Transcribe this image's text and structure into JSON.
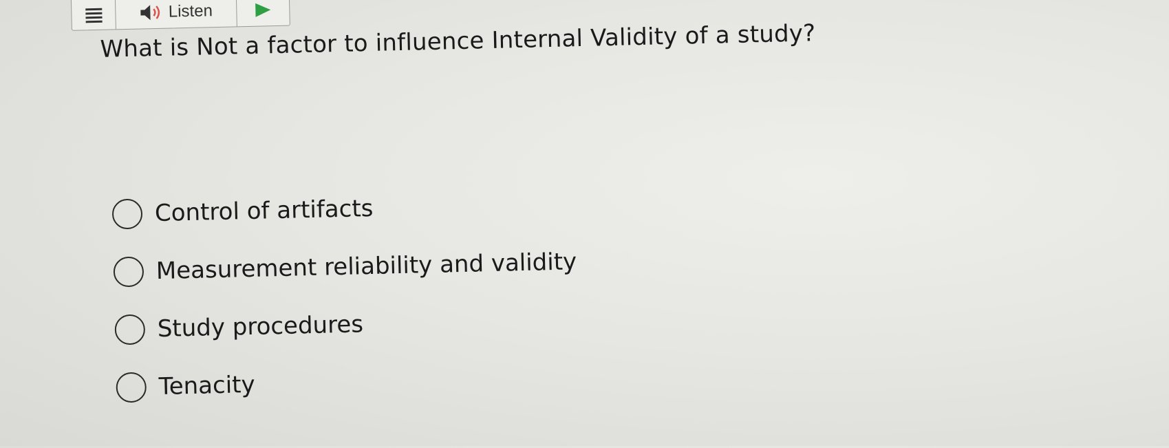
{
  "toolbar": {
    "menu_icon": "hamburger-menu-icon",
    "speaker_icon": "speaker-icon",
    "listen_label": "Listen",
    "play_icon": "play-icon",
    "play_color": "#2ea043"
  },
  "question": {
    "text": "What is Not a factor to influence Internal Validity of a study?"
  },
  "options": [
    {
      "label": "Control of artifacts",
      "selected": false
    },
    {
      "label": "Measurement reliability and validity",
      "selected": false
    },
    {
      "label": "Study procedures",
      "selected": false
    },
    {
      "label": "Tenacity",
      "selected": false
    }
  ]
}
